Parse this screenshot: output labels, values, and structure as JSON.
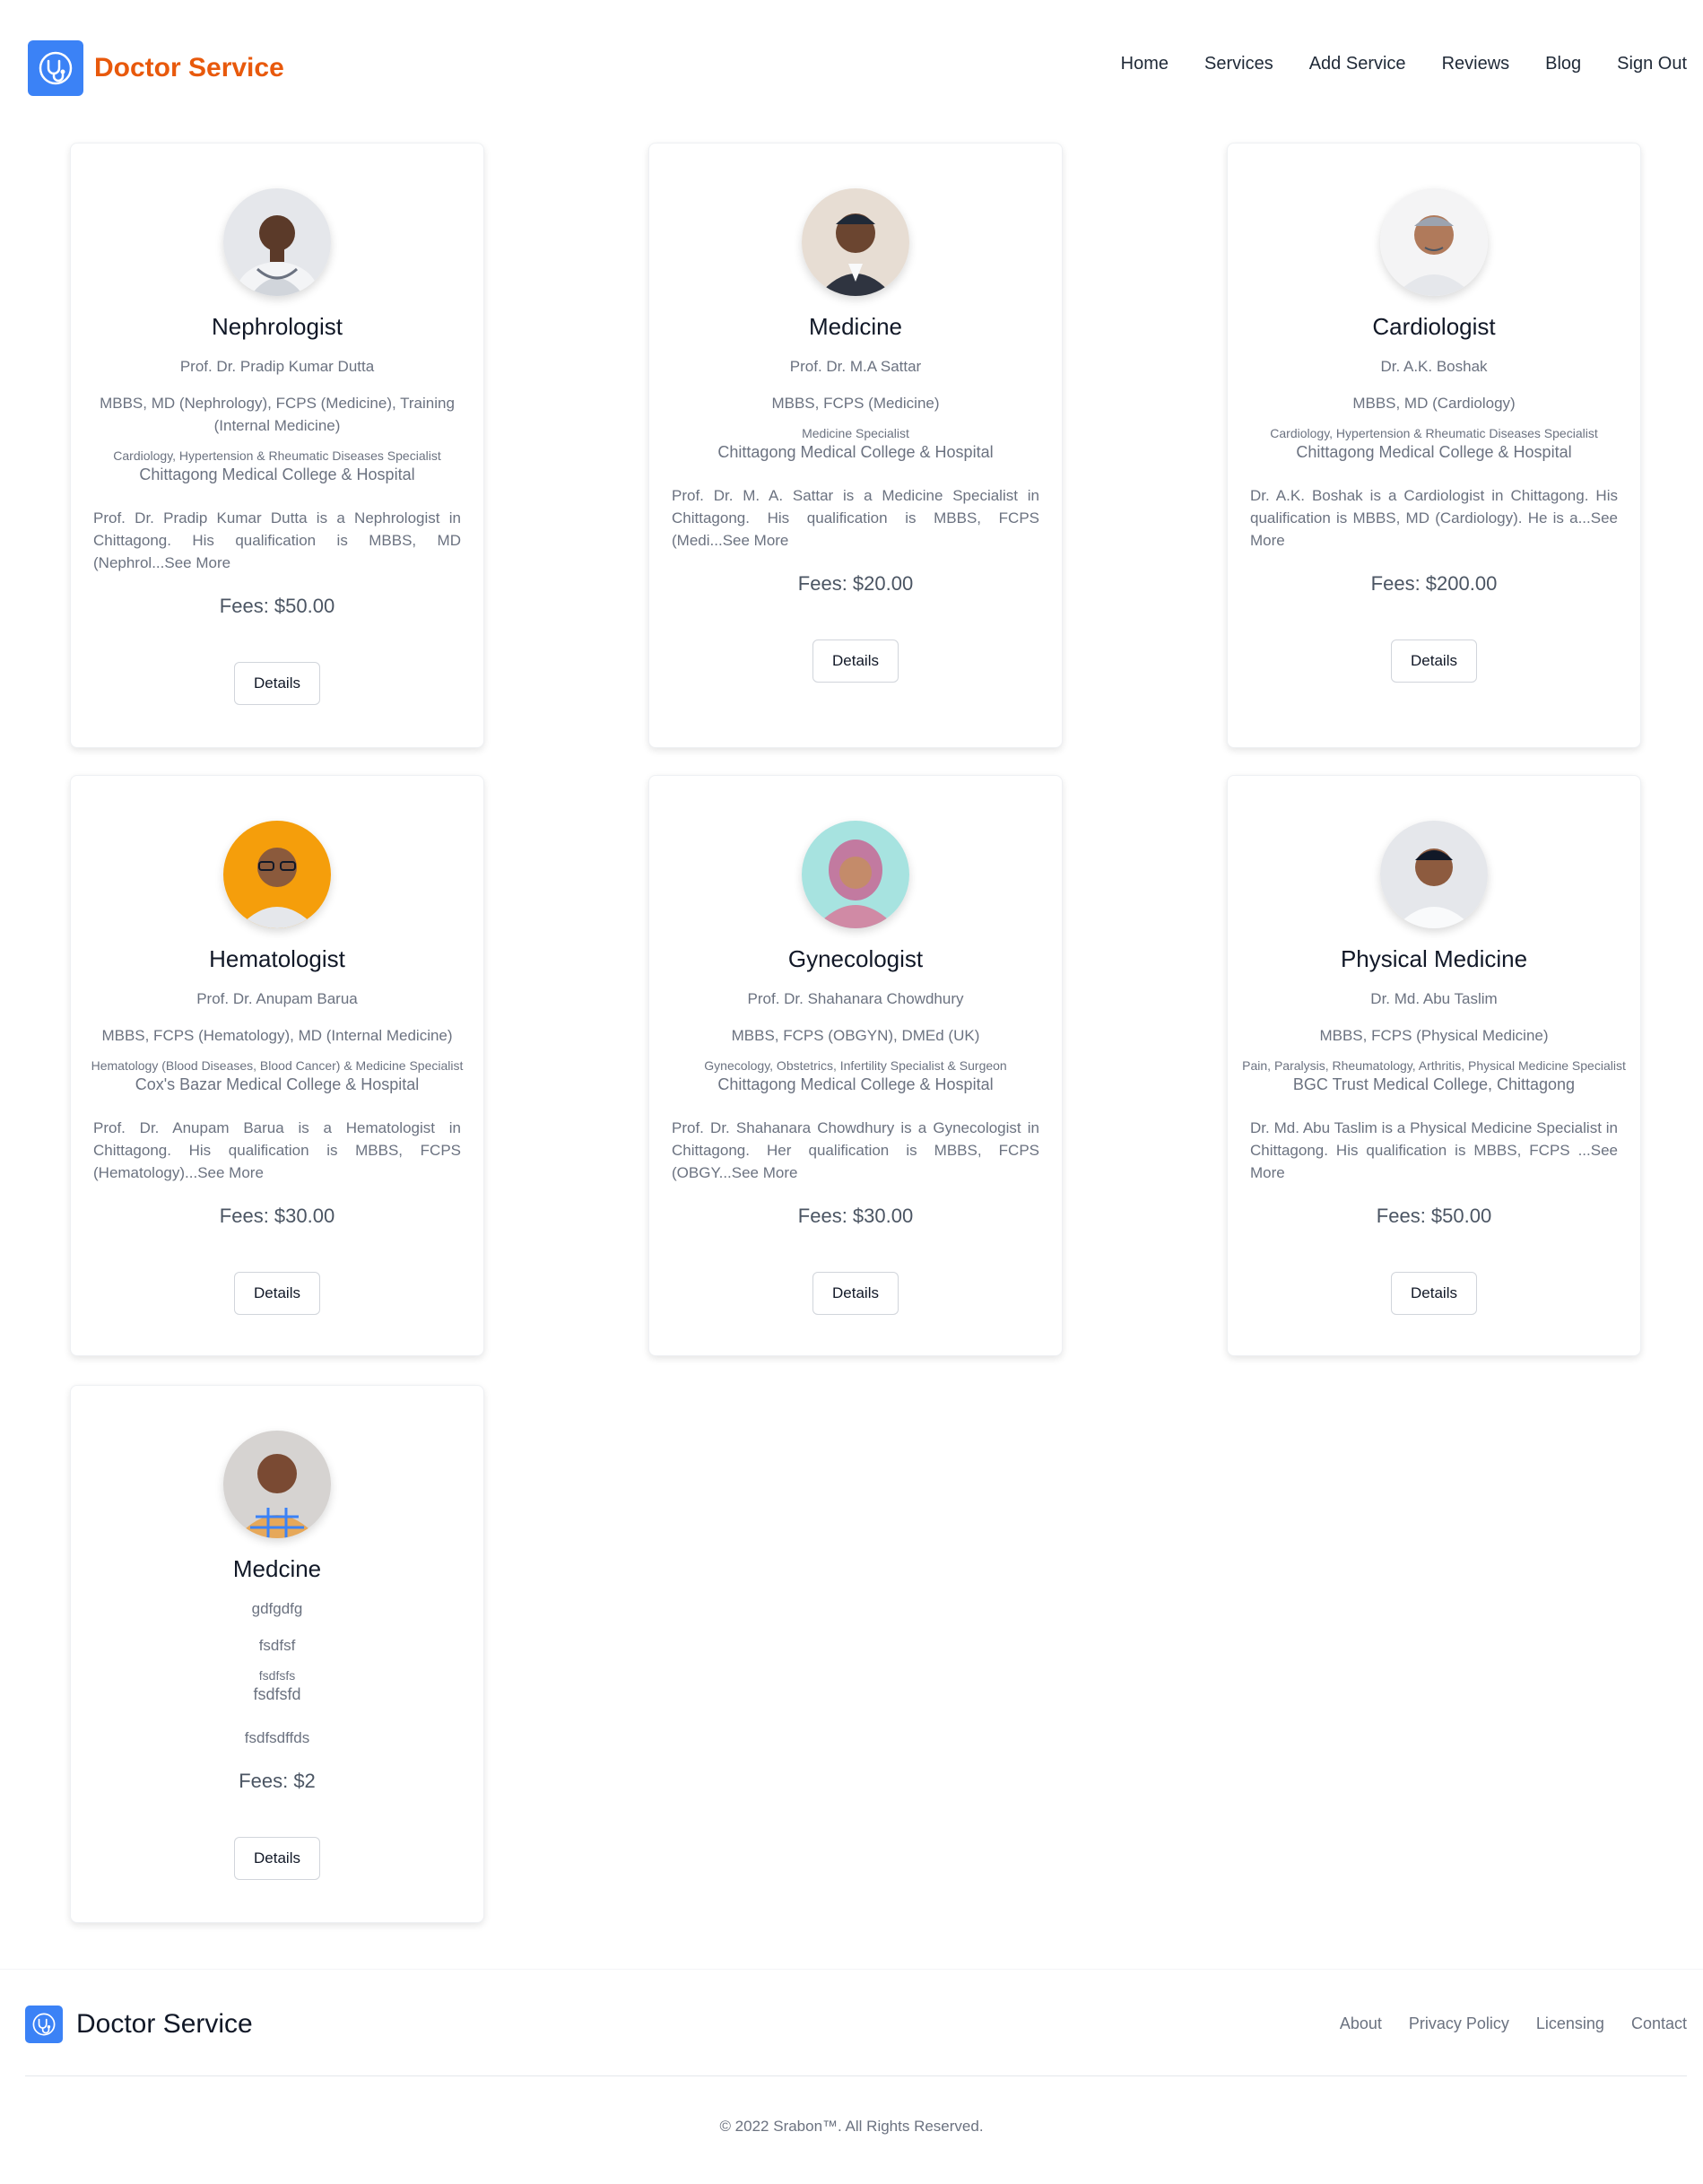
{
  "header": {
    "brand": "Doctor Service",
    "nav": [
      "Home",
      "Services",
      "Add Service",
      "Reviews",
      "Blog",
      "Sign Out"
    ]
  },
  "cards": [
    {
      "title": "Nephrologist",
      "doctor": "Prof. Dr. Pradip Kumar Dutta",
      "degree": "MBBS, MD (Nephrology), FCPS (Medicine), Training (Internal Medicine)",
      "specialty": "Cardiology, Hypertension & Rheumatic Diseases Specialist",
      "hospital": "Chittagong Medical College & Hospital",
      "description": "Prof. Dr. Pradip Kumar Dutta is a Nephrologist in Chittagong. His qualification is MBBS, MD (Nephrol...",
      "see_more": "See More",
      "fees": "Fees: $50.00",
      "button": "Details"
    },
    {
      "title": "Medicine",
      "doctor": "Prof. Dr. M.A Sattar",
      "degree": "MBBS, FCPS (Medicine)",
      "specialty": "Medicine Specialist",
      "hospital": "Chittagong Medical College & Hospital",
      "description": "Prof. Dr. M. A. Sattar is a Medicine Specialist in Chittagong. His qualification is MBBS, FCPS (Medi...",
      "see_more": "See More",
      "fees": "Fees: $20.00",
      "button": "Details"
    },
    {
      "title": "Cardiologist",
      "doctor": "Dr. A.K. Boshak",
      "degree": "MBBS, MD (Cardiology)",
      "specialty": "Cardiology, Hypertension & Rheumatic Diseases Specialist",
      "hospital": "Chittagong Medical College & Hospital",
      "description": "Dr. A.K. Boshak is a Cardiologist in Chittagong. His qualification is MBBS, MD (Cardiology). He is a...",
      "see_more": "See More",
      "fees": "Fees: $200.00",
      "button": "Details"
    },
    {
      "title": "Hematologist",
      "doctor": "Prof. Dr. Anupam Barua",
      "degree": "MBBS, FCPS (Hematology), MD (Internal Medicine)",
      "specialty": "Hematology (Blood Diseases, Blood Cancer) & Medicine Specialist",
      "hospital": "Cox's Bazar Medical College & Hospital",
      "description": "Prof. Dr. Anupam Barua is a Hematologist in Chittagong. His qualification is MBBS, FCPS (Hematology)...",
      "see_more": "See More",
      "fees": "Fees: $30.00",
      "button": "Details"
    },
    {
      "title": "Gynecologist",
      "doctor": "Prof. Dr. Shahanara Chowdhury",
      "degree": "MBBS, FCPS (OBGYN), DMEd (UK)",
      "specialty": "Gynecology, Obstetrics, Infertility Specialist & Surgeon",
      "hospital": "Chittagong Medical College & Hospital",
      "description": "Prof. Dr. Shahanara Chowdhury is a Gynecologist in Chittagong. Her qualification is MBBS, FCPS (OBGY...",
      "see_more": "See More",
      "fees": "Fees: $30.00",
      "button": "Details"
    },
    {
      "title": "Physical Medicine",
      "doctor": "Dr. Md. Abu Taslim",
      "degree": "MBBS, FCPS (Physical Medicine)",
      "specialty": "Pain, Paralysis, Rheumatology, Arthritis, Physical Medicine Specialist",
      "hospital": "BGC Trust Medical College, Chittagong",
      "description": "Dr. Md. Abu Taslim is a Physical Medicine Specialist in Chittagong. His qualification is MBBS, FCPS ...",
      "see_more": "See More",
      "fees": "Fees: $50.00",
      "button": "Details"
    },
    {
      "title": "Medcine",
      "doctor": "gdfgdfg",
      "degree": "fsdfsf",
      "specialty": "fsdfsfs",
      "hospital": "fsdfsfd",
      "description": "fsdfsdffds",
      "see_more": "",
      "fees": "Fees: $2",
      "button": "Details"
    }
  ],
  "footer": {
    "brand": "Doctor Service",
    "links": [
      "About",
      "Privacy Policy",
      "Licensing",
      "Contact"
    ],
    "copyright": "© 2022 Srabon™. All Rights Reserved."
  },
  "colors": {
    "brand_orange": "#e8590c",
    "logo_blue": "#3b82f6"
  }
}
